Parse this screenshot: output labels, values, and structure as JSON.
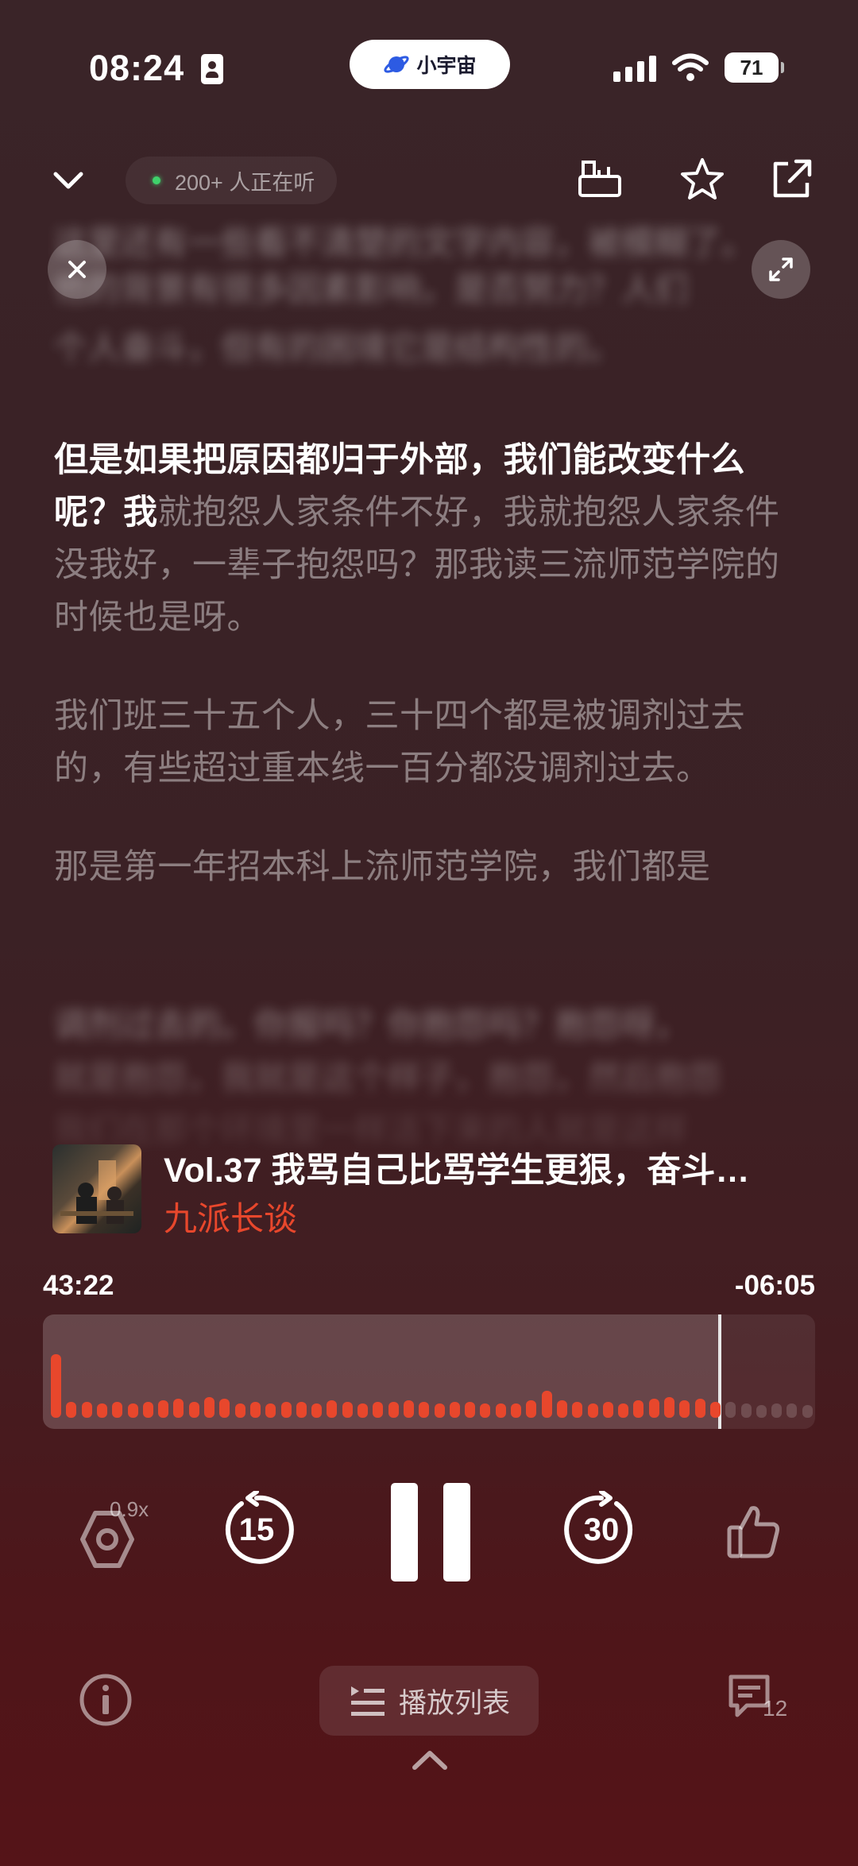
{
  "status_bar": {
    "time": "08:24",
    "battery": "71"
  },
  "dynamic_island": {
    "app_name": "小宇宙"
  },
  "header": {
    "listening_count": "200+ 人正在听"
  },
  "transcript": {
    "blurred_top": [
      "这里还有一些看不清楚的文字内容，被模糊了。",
      "他的背景有很多因素影响，是否努力？人们",
      "个人奋斗，但有的困境它是结构性的。"
    ],
    "paragraph1_highlight": "但是如果把原因都归于外部，我们能改变什么呢？我",
    "paragraph1_rest": "就抱怨人家条件不好，我就抱怨人家条件没我好，一辈子抱怨吗？那我读三流师范学院的时候也是呀。",
    "paragraph2": "我们班三十五个人，三十四个都是被调剂过去的，有些超过重本线一百分都没调剂过去。",
    "paragraph3": "那是第一年招本科上流师范学院，我们都是",
    "blurred_bottom": [
      "调剂过去的。你报吗？你抱怨吗？抱怨呀，",
      "就是抱怨，我就是这个样子，抱怨，然后抱怨",
      "我们在那个环境里一样活下来的人就是这样"
    ]
  },
  "track": {
    "title": "Vol.37 我骂自己比骂学生更狠，奋斗是……",
    "podcast": "九派长谈"
  },
  "progress": {
    "elapsed": "43:22",
    "remaining": "-06:05",
    "fraction": 0.877
  },
  "controls": {
    "speed": "0.9x",
    "rewind_seconds": "15",
    "forward_seconds": "30"
  },
  "bottom": {
    "playlist_label": "播放列表",
    "comment_count": "12"
  },
  "colors": {
    "accent": "#e8472c",
    "online_dot": "#3fd16b"
  }
}
